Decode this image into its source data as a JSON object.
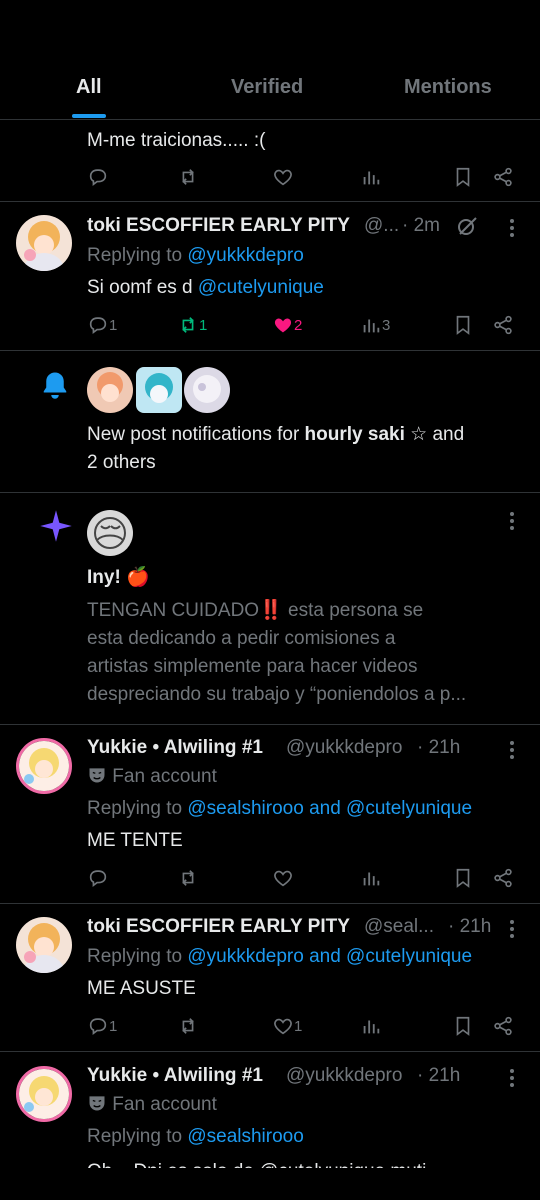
{
  "tabs": [
    {
      "label": "All"
    },
    {
      "label": "Verified"
    },
    {
      "label": "Mentions"
    }
  ],
  "post1": {
    "text": "M-me traicionas..... :("
  },
  "post2": {
    "display_name": "toki ESCOFFIER EARLY PITY",
    "handle": "@...",
    "time": "· 2m",
    "replying_to": "Replying to",
    "reply_target": "@yukkkdepro",
    "text_before": "Si oomf es d",
    "text_mention": "@cutelyunique",
    "replies": "1",
    "reposts": "1",
    "likes": "2",
    "views": "3"
  },
  "notification": {
    "text_prefix": "New post notifications for",
    "text_bold": "hourly saki ☆",
    "text_suffix_1": "and",
    "text_suffix_2": "2 others"
  },
  "recommended": {
    "display_name": "Iny! 🍎",
    "line1": "TENGAN CUIDADO‼️ esta persona se",
    "line2": "esta dedicando a pedir comisiones a",
    "line3": "artistas simplemente para hacer videos",
    "line4": "despreciando su trabajo y “poniendolos a p..."
  },
  "post3": {
    "display_name": "Yukkie • Alwiling #1",
    "handle": "@yukkkdepro",
    "time": "· 21h",
    "badge": "Fan account",
    "replying_to": "Replying to",
    "reply_target": "@sealshirooo and @cutelyunique",
    "text": "ME TENTE"
  },
  "post4": {
    "display_name": "toki ESCOFFIER EARLY PITY",
    "handle": "@seal...",
    "time": "· 21h",
    "replying_to": "Replying to",
    "reply_target": "@yukkkdepro and @cutelyunique",
    "text": "ME ASUSTE",
    "replies": "1",
    "likes": "1"
  },
  "post5": {
    "display_name": "Yukkie • Alwiling #1",
    "handle": "@yukkkdepro",
    "time": "· 21h",
    "badge": "Fan account",
    "replying_to": "Replying to",
    "reply_target": "@sealshirooo",
    "text_partial": "Oh... Dni es solo de @cutelyunique muti..."
  },
  "colors": {
    "background": "#000000",
    "text": "#e7e9ea",
    "muted": "#71767b",
    "link": "#1d9bf0",
    "repost": "#00ba7c",
    "like": "#f91880",
    "bell": "#1d9bf0",
    "sparkle": "#7856ff"
  }
}
